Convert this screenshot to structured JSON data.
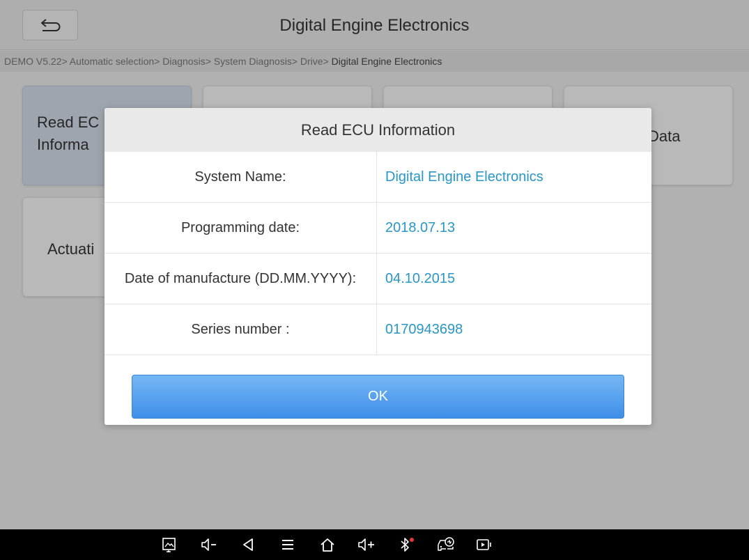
{
  "header": {
    "back_icon": "return-arrow-icon",
    "title": "Digital Engine Electronics"
  },
  "breadcrumb": {
    "path": "DEMO V5.22> Automatic selection> Diagnosis> System Diagnosis> Drive> ",
    "current": "Digital Engine Electronics"
  },
  "tiles": {
    "read_ecu_line1": "Read EC",
    "read_ecu_line2": "Informa",
    "data_fragment": "Data",
    "actuation_fragment": "Actuati"
  },
  "dialog": {
    "title": "Read ECU Information",
    "rows": [
      {
        "label": "System Name:",
        "value": "Digital Engine Electronics"
      },
      {
        "label": "Programming date:",
        "value": "2018.07.13"
      },
      {
        "label": "Date of manufacture (DD.MM.YYYY):",
        "value": "04.10.2015"
      },
      {
        "label": "Series number :",
        "value": "0170943698"
      }
    ],
    "ok_label": "OK",
    "value_color": "#2a96c6",
    "button_color": "#4a95ea"
  },
  "navbar": {
    "icons": [
      "screenshot-icon",
      "volume-down-icon",
      "back-icon",
      "menu-icon",
      "home-icon",
      "volume-up-icon",
      "bluetooth-icon",
      "vehicle-diagnostic-icon",
      "screen-record-icon"
    ],
    "bluetooth_status_color": "#e53935"
  }
}
